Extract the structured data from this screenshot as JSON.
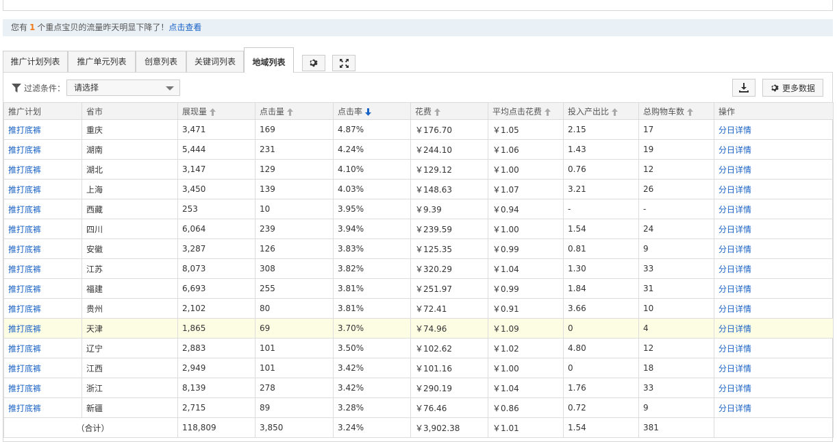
{
  "notice": {
    "prefix": "您有",
    "count": "1",
    "suffix": "个重点宝贝的流量昨天明显下降了！",
    "link": "点击查看"
  },
  "tabs": [
    {
      "label": "推广计划列表"
    },
    {
      "label": "推广单元列表"
    },
    {
      "label": "创意列表"
    },
    {
      "label": "关键词列表"
    },
    {
      "label": "地域列表",
      "active": true
    }
  ],
  "filter": {
    "label": "过滤条件：",
    "select_value": "请选择"
  },
  "toolbar": {
    "more_data_label": "更多数据"
  },
  "table": {
    "columns": [
      "推广计划",
      "省市",
      "展现量",
      "点击量",
      "点击率",
      "花费",
      "平均点击花费",
      "投入产出比",
      "总购物车数",
      "操作"
    ],
    "rows": [
      [
        "推打底裤",
        "重庆",
        "3,471",
        "169",
        "4.87%",
        "￥176.70",
        "￥1.05",
        "2.15",
        "17",
        "分日详情"
      ],
      [
        "推打底裤",
        "湖南",
        "5,444",
        "231",
        "4.24%",
        "￥244.10",
        "￥1.06",
        "1.43",
        "19",
        "分日详情"
      ],
      [
        "推打底裤",
        "湖北",
        "3,147",
        "129",
        "4.10%",
        "￥129.12",
        "￥1.00",
        "0.76",
        "12",
        "分日详情"
      ],
      [
        "推打底裤",
        "上海",
        "3,450",
        "139",
        "4.03%",
        "￥148.63",
        "￥1.07",
        "3.21",
        "26",
        "分日详情"
      ],
      [
        "推打底裤",
        "西藏",
        "253",
        "10",
        "3.95%",
        "￥9.39",
        "￥0.94",
        "-",
        "-",
        "分日详情"
      ],
      [
        "推打底裤",
        "四川",
        "6,064",
        "239",
        "3.94%",
        "￥239.59",
        "￥1.00",
        "1.54",
        "24",
        "分日详情"
      ],
      [
        "推打底裤",
        "安徽",
        "3,287",
        "126",
        "3.83%",
        "￥125.35",
        "￥0.99",
        "0.81",
        "9",
        "分日详情"
      ],
      [
        "推打底裤",
        "江苏",
        "8,073",
        "308",
        "3.82%",
        "￥320.29",
        "￥1.04",
        "1.30",
        "33",
        "分日详情"
      ],
      [
        "推打底裤",
        "福建",
        "6,693",
        "255",
        "3.81%",
        "￥251.97",
        "￥0.99",
        "1.84",
        "31",
        "分日详情"
      ],
      [
        "推打底裤",
        "贵州",
        "2,102",
        "80",
        "3.81%",
        "￥72.41",
        "￥0.91",
        "3.66",
        "10",
        "分日详情"
      ],
      [
        "推打底裤",
        "天津",
        "1,865",
        "69",
        "3.70%",
        "￥74.96",
        "￥1.09",
        "0",
        "4",
        "分日详情"
      ],
      [
        "推打底裤",
        "辽宁",
        "2,883",
        "101",
        "3.50%",
        "￥102.62",
        "￥1.02",
        "4.80",
        "12",
        "分日详情"
      ],
      [
        "推打底裤",
        "江西",
        "2,949",
        "101",
        "3.42%",
        "￥101.16",
        "￥1.00",
        "0",
        "18",
        "分日详情"
      ],
      [
        "推打底裤",
        "浙江",
        "8,139",
        "278",
        "3.42%",
        "￥290.19",
        "￥1.04",
        "1.76",
        "33",
        "分日详情"
      ],
      [
        "推打底裤",
        "新疆",
        "2,715",
        "89",
        "3.28%",
        "￥76.46",
        "￥0.86",
        "0.72",
        "9",
        "分日详情"
      ]
    ],
    "highlight_row": 10,
    "total": {
      "label": "（合计）",
      "values": [
        "118,809",
        "3,850",
        "3.24%",
        "￥3,902.38",
        "￥1.01",
        "1.54",
        "381"
      ]
    }
  },
  "colors": {
    "link": "#1a63c6",
    "accent_number": "#f07d1a",
    "notice_bg": "#e9f0f6",
    "highlight_row": "#fdfde4"
  },
  "icons": [
    "gear-icon",
    "fullscreen-icon",
    "filter-icon",
    "download-icon",
    "sort-arrow-icon"
  ]
}
